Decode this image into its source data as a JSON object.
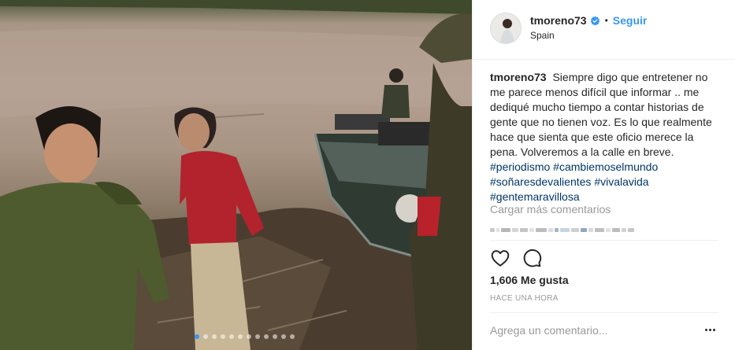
{
  "post": {
    "username": "tmoreno73",
    "verified_icon": "verified-badge-icon",
    "separator": "•",
    "follow_label": "Seguir",
    "location": "Spain",
    "caption_text": "Siempre digo que entretener no me parece menos difícil que informar .. me dediqué mucho tiempo a contar historias de gente que no tienen voz. Es lo que realmente hace que sienta que este oficio merece la pena. Volveremos a la calle en breve.",
    "hashtags": [
      "#periodismo",
      "#cambiemoselmundo",
      "#soñaresdevalientes",
      "#vivalavida",
      "#gentemaravillosa"
    ],
    "load_more_label": "Cargar más comentarios",
    "likes": "1,606 Me gusta",
    "time_ago": "HACE UNA HORA",
    "comment_placeholder": "Agrega un comentario...",
    "carousel": {
      "total": 12,
      "active_index": 0
    }
  },
  "icons": {
    "like": "heart-outline-icon",
    "comment": "comment-bubble-icon",
    "more": "more-options-icon"
  },
  "colors": {
    "link_blue": "#3897f0",
    "hashtag": "#003569",
    "muted_text": "#999999",
    "text": "#262626",
    "border": "#efefef"
  }
}
